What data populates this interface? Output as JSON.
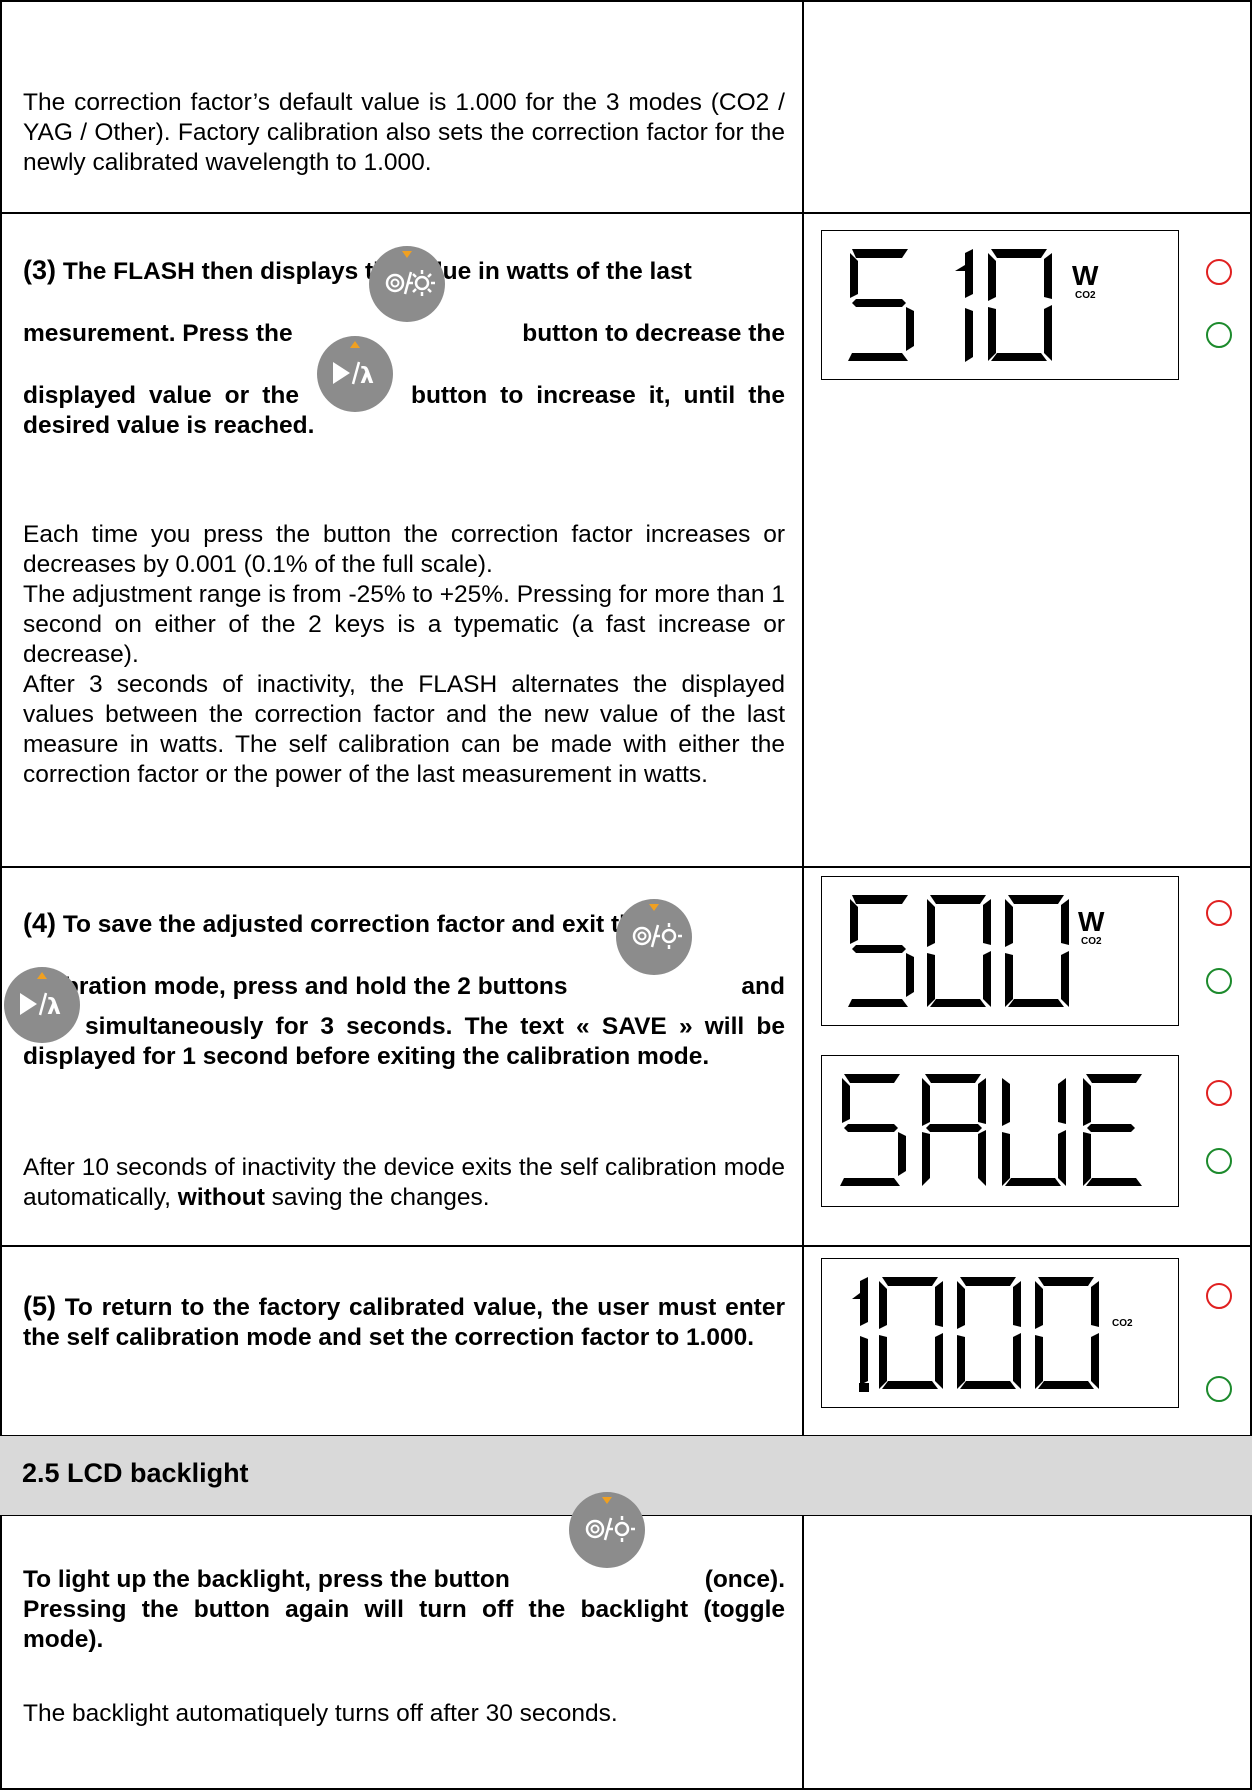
{
  "intro": {
    "text": "The correction factor’s default value is 1.000 for the 3 modes (CO2 / YAG / Other). Factory calibration also sets the correction factor for the newly calibrated wavelength to 1.000."
  },
  "step3": {
    "num": "(3)",
    "line1": "The FLASH then displays the value in watts of the last",
    "line2a": "mesurement.  Press the",
    "line2b": "button to decrease the",
    "line3a": "displayed value or the",
    "line3b": "button to increase it, until the desired value is reached.",
    "p1": "Each time you press the button the correction factor increases or decreases by 0.001 (0.1% of the full scale).",
    "p2": "The adjustment range is from -25% to +25%.  Pressing for more than 1 second on either of the 2 keys is a typematic (a fast increase or decrease).",
    "p3": "After 3 seconds of inactivity, the FLASH alternates the displayed values between the correction factor and the new value of the last measure in watts.  The self calibration can be made with either the correction factor or the power of the last measurement in watts.",
    "lcd": {
      "digits": "510",
      "unit": "W",
      "mode": "CO2"
    }
  },
  "step4": {
    "num": "(4)",
    "line1": "To save the adjusted correction factor and exit the",
    "line2a": "calibration mode, press and hold the 2 buttons",
    "line2b": "and",
    "line3": "simultaneously for 3 seconds.  The text « SAVE » will be displayed for 1 second before exiting the calibration mode.",
    "p1a": "After 10 seconds of inactivity the device exits the self calibration mode automatically, ",
    "p1b": "without",
    "p1c": " saving the changes.",
    "lcd1": {
      "digits": "500",
      "unit": "W",
      "mode": "CO2"
    },
    "lcd2": {
      "digits": "SAVE"
    }
  },
  "step5": {
    "num": "(5)",
    "text": "To return to the factory calibrated value, the user must enter the self calibration mode and set the correction factor to 1.000.",
    "lcd": {
      "digits": "1.000",
      "mode": "CO2"
    }
  },
  "section": {
    "title": "2.5  LCD backlight"
  },
  "backlight": {
    "line1a": "To light up the backlight, press the button",
    "line1b": "(once).",
    "line2": "Pressing the button again will turn off the backlight (toggle mode).",
    "p1": "The backlight automatiquely turns off after 30 seconds."
  },
  "buttons": {
    "power_light": "power-light-button-icon",
    "play_lambda": "play-lambda-button-icon"
  },
  "colors": {
    "led_red": "#e02020",
    "led_green": "#1c8a2c",
    "button_gray": "#8c8c8c",
    "button_arrow": "#f0a020",
    "section_bg": "#d9d9d9"
  }
}
